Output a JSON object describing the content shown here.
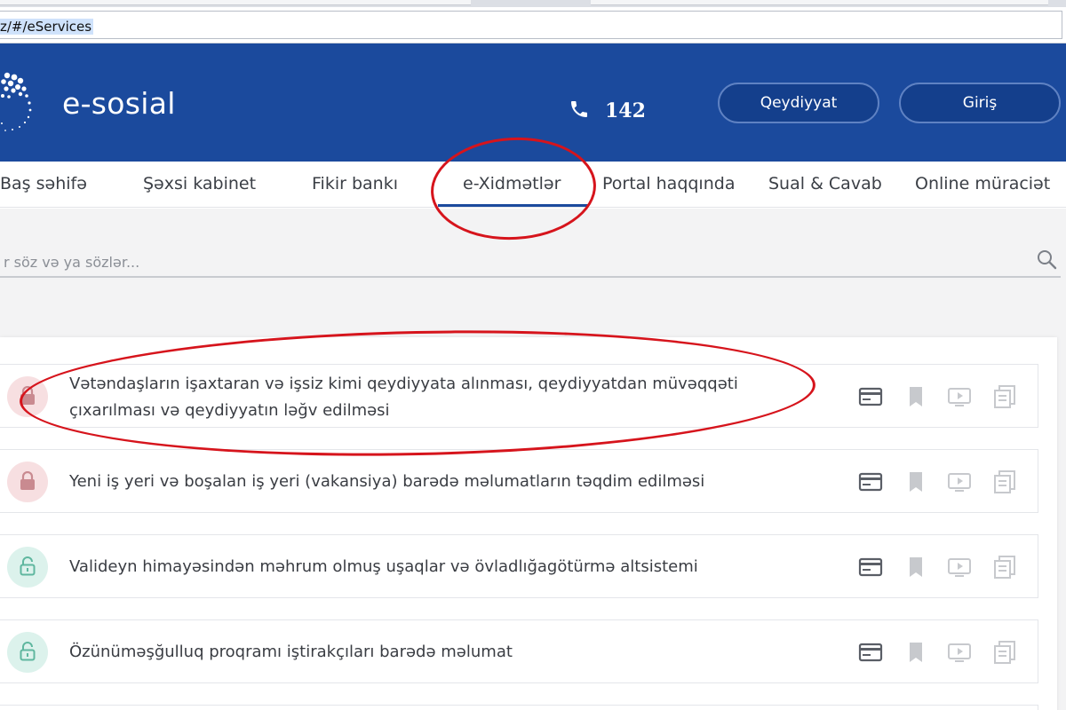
{
  "browser": {
    "url": "z/#/eServices"
  },
  "header": {
    "brand": "e-sosial",
    "logo_icon": "dotted-circle-logo-icon",
    "phone_icon": "phone-icon",
    "phone_number": "142",
    "register_label": "Qeydiyyat",
    "login_label": "Giriş",
    "colors": {
      "header_bg": "#1b4a9d",
      "button_border": "#5f82c3"
    }
  },
  "nav": {
    "items": [
      {
        "label": "Baş səhifə"
      },
      {
        "label": "Şəxsi kabinet"
      },
      {
        "label": "Fikir bankı"
      },
      {
        "label": "e-Xidmətlər",
        "active": true
      },
      {
        "label": "Portal haqqında"
      },
      {
        "label": "Sual & Cavab"
      },
      {
        "label": "Online müraciət"
      }
    ],
    "active_color": "#1b4a9d"
  },
  "search": {
    "placeholder": "r söz və ya sözlər..."
  },
  "services": [
    {
      "title": "Vətəndaşların işaxtaran və işsiz kimi qeydiyyata alınması, qeydiyyatdan müvəqqəti çıxarılması və qeydiyyatın ləğv edilməsi",
      "status": "locked"
    },
    {
      "title": "Yeni iş yeri və boşalan iş yeri (vakansiya) barədə məlumatların təqdim edilməsi",
      "status": "locked"
    },
    {
      "title": "Valideyn himayəsindən məhrum olmuş uşaqlar və övladlığagötürmə altsistemi",
      "status": "open"
    },
    {
      "title": "Özünüməşğulluq proqramı iştirakçıları barədə məlumat",
      "status": "open"
    }
  ],
  "row_actions": [
    "card-icon",
    "bookmark-icon",
    "video-icon",
    "documents-icon"
  ],
  "colors": {
    "locked_badge": "#f7dfe1",
    "locked_icon": "#c98a90",
    "open_badge": "#dcf2ec",
    "open_icon": "#5fb79f",
    "annotation": "#d6141c"
  }
}
